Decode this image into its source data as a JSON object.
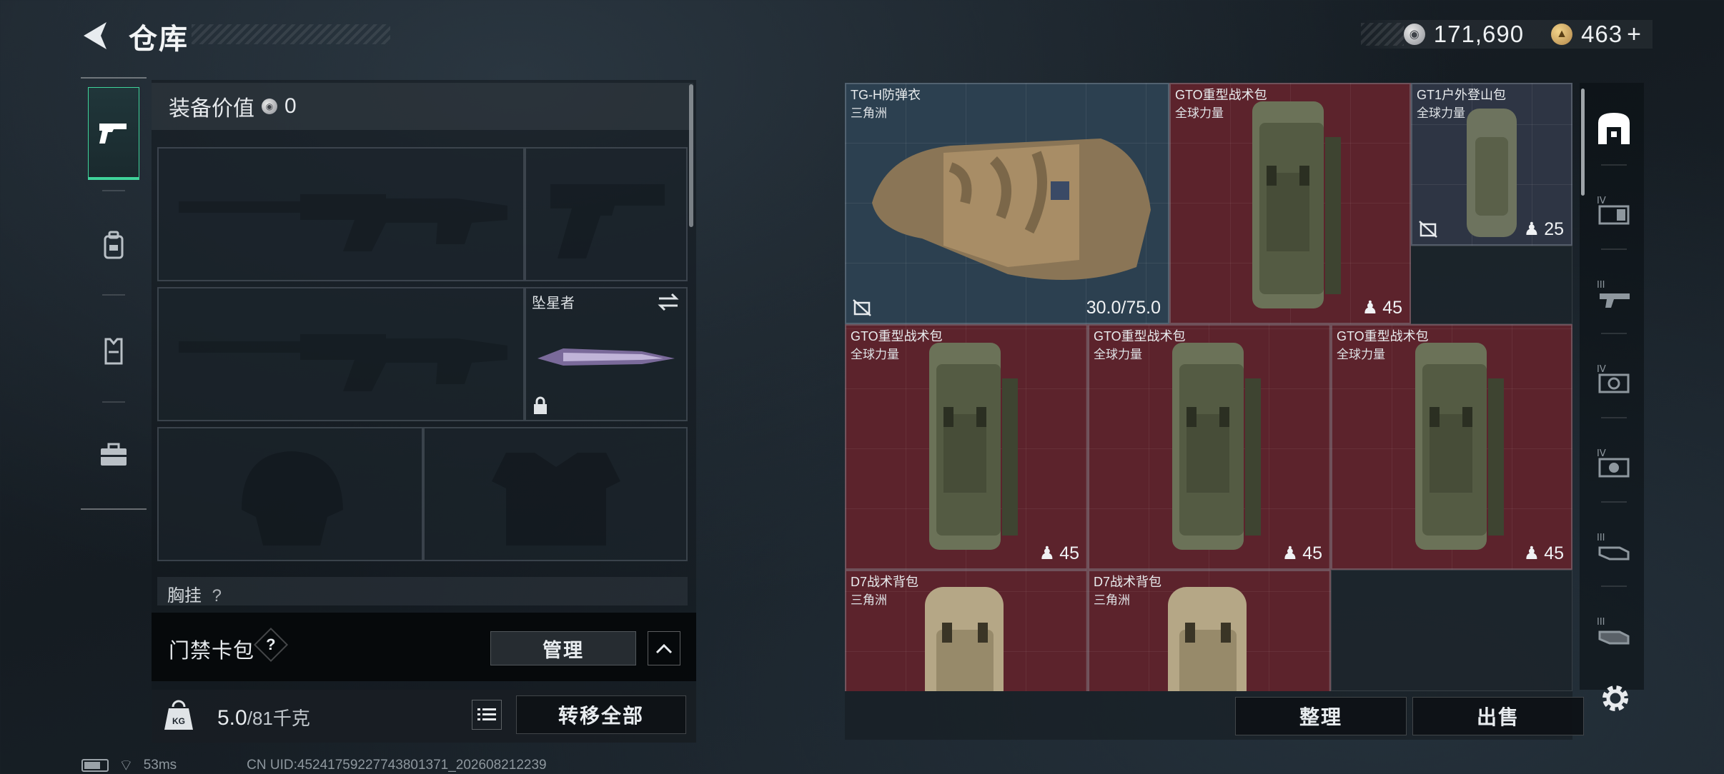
{
  "header": {
    "title": "仓库",
    "currency_silver": "171,690",
    "currency_gold": "463",
    "currency_add": "+"
  },
  "left_nav": {
    "items": [
      {
        "icon": "pistol-icon",
        "active": true
      },
      {
        "icon": "backpack-icon",
        "active": false
      },
      {
        "icon": "vest-icon",
        "active": false
      },
      {
        "icon": "toolbox-icon",
        "active": false
      }
    ]
  },
  "loadout": {
    "equip_value_label": "装备价值",
    "equip_value": "0",
    "melee_slot_label": "坠星者",
    "chest_label": "胸挂",
    "chest_hint": "?"
  },
  "keycard": {
    "label": "门禁卡包",
    "help": "?",
    "manage": "管理"
  },
  "weight": {
    "current": "5.0",
    "max": "/81",
    "unit": "千克",
    "transfer_all": "转移全部",
    "kg_badge": "KG"
  },
  "status": {
    "ping": "53ms",
    "uid": "CN UID:45241759227743801371_202608212239"
  },
  "warehouse": {
    "items": [
      {
        "name": "TG-H防弹衣",
        "sub": "三角洲",
        "meta": "30.0/75.0",
        "color": "blue"
      },
      {
        "name": "GTO重型战术包",
        "sub": "全球力量",
        "meta": "45",
        "color": "red"
      },
      {
        "name": "GT1户外登山包",
        "sub": "全球力量",
        "meta": "25",
        "color": "slate"
      },
      {
        "name": "GTO重型战术包",
        "sub": "全球力量",
        "meta": "45",
        "color": "red"
      },
      {
        "name": "GTO重型战术包",
        "sub": "全球力量",
        "meta": "45",
        "color": "red"
      },
      {
        "name": "GTO重型战术包",
        "sub": "全球力量",
        "meta": "45",
        "color": "red"
      },
      {
        "name": "D7战术背包",
        "sub": "三角洲",
        "meta": "",
        "color": "red"
      },
      {
        "name": "D7战术背包",
        "sub": "三角洲",
        "meta": "",
        "color": "red"
      }
    ],
    "sort_label": "整理",
    "sell_label": "出售"
  },
  "right_filters": [
    {
      "icon": "storage-icon",
      "active": true
    },
    {
      "icon": "rifle-case-iv-icon",
      "tier": "IV"
    },
    {
      "icon": "gun-iii-icon",
      "tier": "III"
    },
    {
      "icon": "camera-iv-icon",
      "tier": "IV"
    },
    {
      "icon": "camera-iv-alt-icon",
      "tier": "IV"
    },
    {
      "icon": "hand-iii-icon",
      "tier": "III"
    },
    {
      "icon": "hand-iii-alt-icon",
      "tier": "III"
    }
  ],
  "colors": {
    "accent_green": "#3fd39a",
    "item_red": "#5c232c",
    "item_blue": "#2c4050",
    "item_slate": "#2e3544"
  }
}
